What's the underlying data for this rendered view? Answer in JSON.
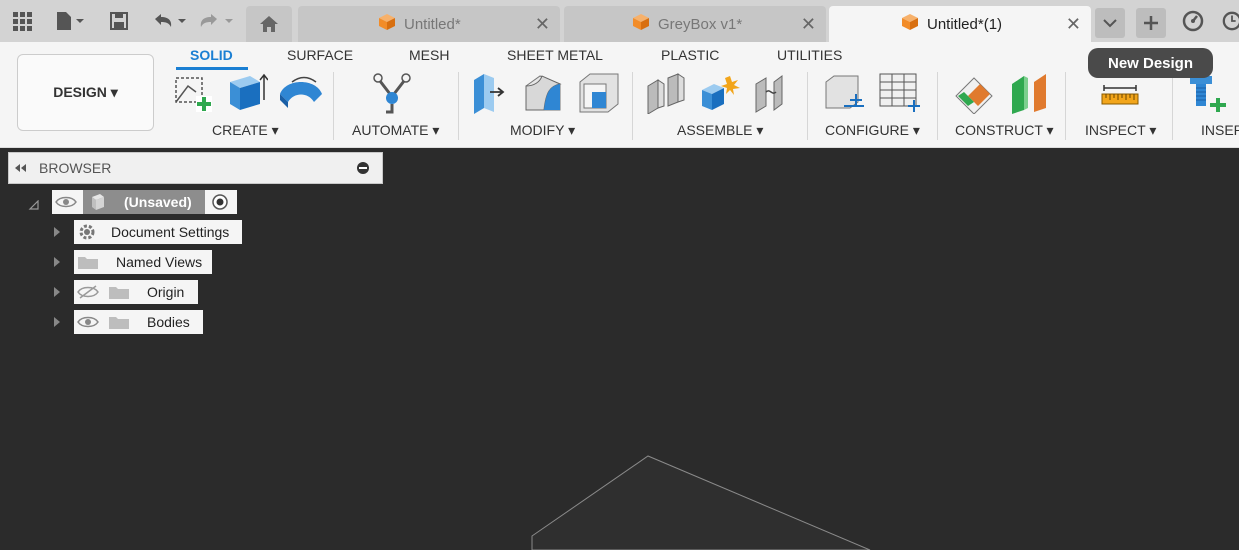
{
  "tabbar": {
    "tabs": [
      {
        "title": "Untitled*",
        "active": false
      },
      {
        "title": "GreyBox v1*",
        "active": false
      },
      {
        "title": "Untitled*(1)",
        "active": true
      }
    ],
    "close_glyph": "✕"
  },
  "ribbon": {
    "design_label": "DESIGN ▾",
    "tabs": [
      "SOLID",
      "SURFACE",
      "MESH",
      "SHEET METAL",
      "PLASTIC",
      "UTILITIES"
    ],
    "active_tab": "SOLID",
    "groups": [
      "CREATE ▾",
      "AUTOMATE ▾",
      "MODIFY ▾",
      "ASSEMBLE ▾",
      "CONFIGURE ▾",
      "CONSTRUCT ▾",
      "INSPECT ▾",
      "INSER"
    ],
    "tooltip": "New Design"
  },
  "browser": {
    "title": "BROWSER",
    "root_label": "(Unsaved)",
    "items": [
      "Document Settings",
      "Named Views",
      "Origin",
      "Bodies"
    ]
  },
  "colors": {
    "accent": "#1a7fd3",
    "canvas": "#2b2b2b",
    "ribbon_bg": "#f5f5f5",
    "tab_strip": "#d3d3d3",
    "tooltip_bg": "#4a4a4a",
    "orange_cube": "#f28c28"
  }
}
